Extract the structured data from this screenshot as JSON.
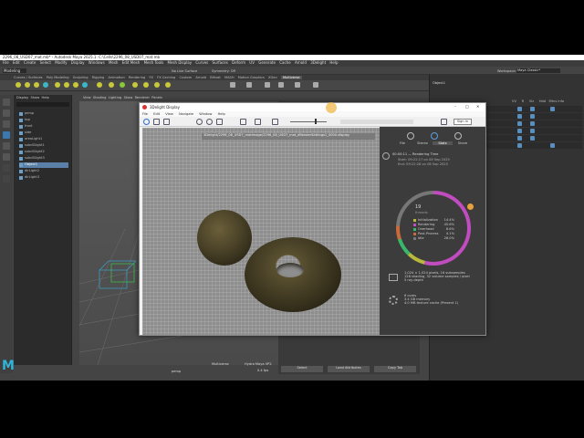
{
  "maya": {
    "title": "2296_08_USD07_mat.mb* - Autodesk Maya 2025.1: C:\\Cells\\2296_08_USD07_mat.mb",
    "menu": [
      "File",
      "Edit",
      "Create",
      "Select",
      "Modify",
      "Display",
      "Windows",
      "Mesh",
      "Edit Mesh",
      "Mesh Tools",
      "Mesh Display",
      "Curves",
      "Surfaces",
      "Deform",
      "UV",
      "Generate",
      "Cache",
      "Arnold",
      "3Delight",
      "Help"
    ],
    "mode": "Modeling",
    "no_live_surface": "No Live Surface",
    "symmetry": "Symmetry: Off",
    "workspace_label": "Workspace:",
    "workspace_value": "Maya Classic*",
    "shelf_tabs": [
      "Curves / Surfaces",
      "Poly Modeling",
      "Sculpting",
      "Rigging",
      "Animation",
      "Rendering",
      "FX",
      "FX Caching",
      "Custom",
      "Arnold",
      "Bifrost",
      "MASH",
      "Motion Graphics",
      "XGen",
      "Multiverse"
    ],
    "shelf_icons": [
      "SUB",
      "SPH",
      "CYL",
      "CUB",
      "TOR",
      "PLN",
      "ARE",
      "LGT",
      "ENV",
      "RND",
      "NSI",
      "DLG",
      "MTL",
      "SHD",
      "USD",
      "VIEW"
    ],
    "outliner_menu": [
      "Display",
      "Show",
      "Help"
    ],
    "outliner_items": [
      "persp",
      "top",
      "front",
      "side",
      "areaLight1",
      "subdGlight1",
      "subdGlight2",
      "subdGlight3",
      "Object1",
      "dirLight2",
      "dirLight3"
    ],
    "outliner_selected": "Object1",
    "viewport_menu": [
      "View",
      "Shading",
      "Lighting",
      "Show",
      "Renderer",
      "Panels"
    ],
    "viewport_label": "persp",
    "viewport_renderer": "Multiverse",
    "viewport_hydra": "Hydra Maya VP2",
    "viewport_fps": "0.4 fps",
    "channel_title": "Object1",
    "channel_header": [
      "VV",
      "R",
      "Viz",
      "Hdd",
      "Mtns info"
    ],
    "bottom_buttons": [
      "Select",
      "Load Attributes",
      "Copy Tab"
    ]
  },
  "delight": {
    "title": "3Delight Display",
    "menu": [
      "File",
      "Edit",
      "View",
      "Navigate",
      "Window",
      "Help"
    ],
    "sign_in": "Sign In",
    "path": "3Delight/2296_08_USD7_matImage/2296_08_USD7_mat_dRenderSettings1_0000.display",
    "side_tabs": [
      "File",
      "Stereo",
      "Stats",
      "Share"
    ],
    "active_tab": "Stats",
    "elapsed": "00:00:11 — Rendering Time",
    "started": "Start: 09:22:17 on 08 Sep 2025",
    "finished": "End: 09:22:28 on 08 Sep 2025",
    "ring_total": "19",
    "ring_unit": "threads",
    "stats": [
      {
        "label": "Initialization",
        "value": "14.4%",
        "color": "#b8b83a"
      },
      {
        "label": "Rendering",
        "value": "45.6%",
        "color": "#c04cc0"
      },
      {
        "label": "Overhead",
        "value": "8.6%",
        "color": "#3ab86a"
      },
      {
        "label": "Post-Process",
        "value": "4.1%",
        "color": "#c86a3a"
      },
      {
        "label": "Idle",
        "value": "28.0%",
        "color": "#777777"
      }
    ],
    "resolution_lines": [
      "1,024 × 1,024 pixels, 16 subsamples",
      "128 shading, 32 volume samples / pixel",
      "5 ray-depth"
    ],
    "memory_lines": [
      "6 cores",
      "3.4 GB memory",
      "4.0 MB texture cache (Present 1)"
    ]
  }
}
